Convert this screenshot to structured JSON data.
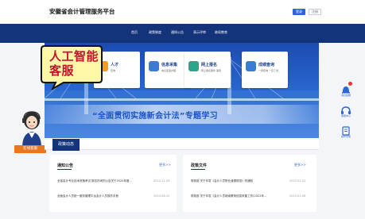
{
  "header": {
    "site_title": "安徽省会计管理服务平台",
    "login_label": "登录",
    "register_label": "注册"
  },
  "nav": {
    "items": [
      "首页",
      "政策制度",
      "通知公告",
      "表示评审",
      "继续教育"
    ]
  },
  "hero": {
    "cards": [
      {
        "title": "人才",
        "subtitle": "查询",
        "icon": "people-icon",
        "color": "#f39a2b"
      },
      {
        "title": "信息采集",
        "subtitle": "信息变更办理",
        "icon": "id-card-icon",
        "color": "#3a7bd5"
      },
      {
        "title": "网上报名",
        "subtitle": "网上报名服务 事项",
        "icon": "form-icon",
        "color": "#2aa58a"
      },
      {
        "title": "成绩查询",
        "subtitle": "一键查询 一目了然",
        "icon": "chart-icon",
        "color": "#3a7bd5"
      }
    ],
    "slogan": "“全面贯彻实施新会计法”专题学习"
  },
  "assistant": {
    "bubble_text": "人工智能客服",
    "mascot_label": "在线客服"
  },
  "section": {
    "tab_label": "政策动态"
  },
  "notices": {
    "title": "通知公告",
    "more": "更多>>",
    "rows": [
      {
        "text": "全省会计专业技术资格考试 报名时间的公告关于2025年度...",
        "date": "2024-12-25"
      },
      {
        "text": "全面会计人员统一服务管理平台会计人员操作手册",
        "date": "2024-08-15"
      }
    ]
  },
  "policies": {
    "title": "政策文件",
    "more": "更多>>",
    "rows": [
      {
        "text": "财政部 关于印发《会计人员职业道德规范》的通知",
        "date": "2023-01-01"
      },
      {
        "text": "财政部 关于印发《会计人员继续教育信息采集工作(2022年...",
        "date": "2023-01-06"
      }
    ]
  },
  "sidebar": {
    "items": [
      {
        "label": "消息提醒",
        "icon": "bell-icon",
        "badge": "2"
      },
      {
        "label": "客服中心",
        "icon": "headset-icon"
      },
      {
        "label": "操作手册",
        "icon": "manual-icon"
      }
    ]
  },
  "colors": {
    "nav_bg": "#13337a",
    "accent": "#2a66d9",
    "alert_red": "#c8102e",
    "orange": "#e87722"
  }
}
